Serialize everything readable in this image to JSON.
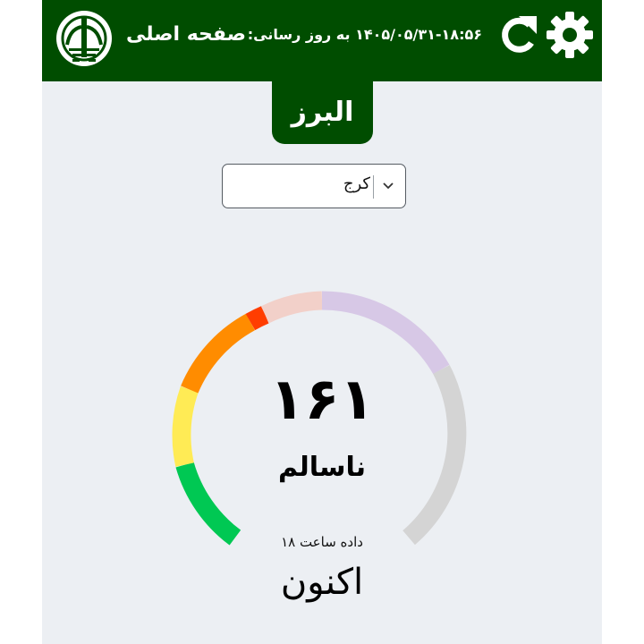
{
  "header": {
    "page_title": "صفحه اصلی",
    "update_text": "۱۴۰۵/۰۵/۳۱-۱۸:۵۶  به روز رسانی:",
    "icons": {
      "logo": "environment-logo",
      "refresh": "refresh-icon",
      "settings": "gear-icon"
    }
  },
  "province": {
    "name": "البرز"
  },
  "city_select": {
    "value": "کرج"
  },
  "aqi": {
    "value": "۱۶۱",
    "status": "ناسالم",
    "data_hour": "داده ساعت ۱۸",
    "now_label": "اکنون"
  },
  "colors": {
    "header": "#004d00",
    "background": "#eceff3",
    "good": "#00c853",
    "moderate": "#ffeb55",
    "usg": "#ff8c00",
    "unhealthy": "#ff3d00",
    "very_unhealthy": "#f2d0c9",
    "hazardous": "#d7c8e6",
    "remaining": "#d4d4d4"
  }
}
